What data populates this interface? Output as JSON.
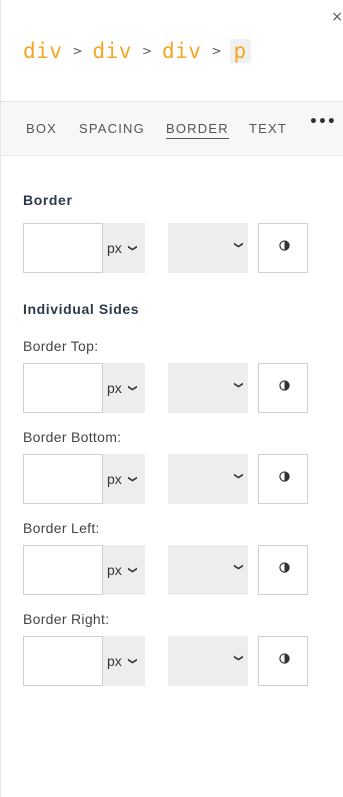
{
  "close_label": "×",
  "breadcrumb": [
    "div",
    "div",
    "div",
    "p"
  ],
  "breadcrumb_separator": ">",
  "tabs": [
    "BOX",
    "SPACING",
    "BORDER",
    "TEXT"
  ],
  "active_tab": "BORDER",
  "more_label": "•••",
  "border_section": {
    "title": "Border",
    "unit": "px"
  },
  "individual_section": {
    "title": "Individual Sides",
    "sides": [
      {
        "label": "Border Top:",
        "unit": "px"
      },
      {
        "label": "Border Bottom:",
        "unit": "px"
      },
      {
        "label": "Border Left:",
        "unit": "px"
      },
      {
        "label": "Border Right:",
        "unit": "px"
      }
    ]
  },
  "colors": {
    "accent": "#f5a623",
    "title_text": "#2d3a4a",
    "select_bg": "#ededed"
  },
  "icons": {
    "color": "half-circle-contrast-icon",
    "dropdown": "chevron-down-icon"
  }
}
